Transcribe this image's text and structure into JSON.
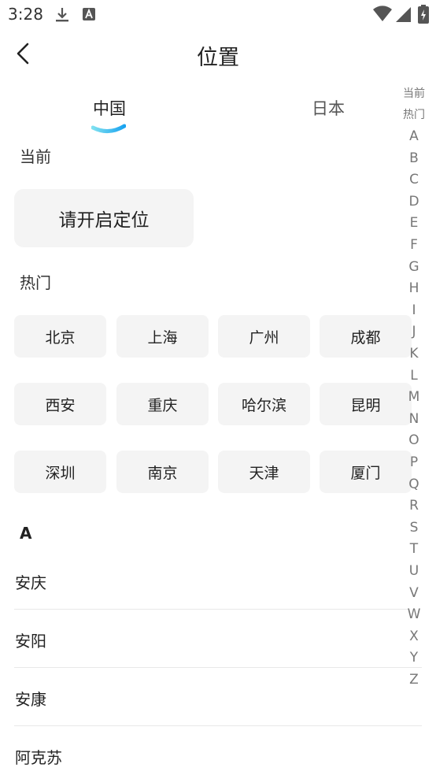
{
  "status_bar": {
    "time": "3:28"
  },
  "nav": {
    "title": "位置"
  },
  "tabs": [
    {
      "label": "中国",
      "active": true
    },
    {
      "label": "日本",
      "active": false
    }
  ],
  "current_section": {
    "label": "当前",
    "locate_button": "请开启定位"
  },
  "hot_section": {
    "label": "热门",
    "cities": [
      "北京",
      "上海",
      "广州",
      "成都",
      "西安",
      "重庆",
      "哈尔滨",
      "昆明",
      "深圳",
      "南京",
      "天津",
      "厦门"
    ]
  },
  "city_list": {
    "group_letter": "A",
    "items": [
      "安庆",
      "安阳",
      "安康",
      "阿克苏"
    ]
  },
  "index_bar": [
    "当前",
    "热门",
    "A",
    "B",
    "C",
    "D",
    "E",
    "F",
    "G",
    "H",
    "I",
    "J",
    "K",
    "L",
    "M",
    "N",
    "O",
    "P",
    "Q",
    "R",
    "S",
    "T",
    "U",
    "V",
    "W",
    "X",
    "Y",
    "Z"
  ],
  "colors": {
    "accent_start": "#7ee0f0",
    "accent_end": "#1aa3f0",
    "chip_bg": "#f4f4f4"
  }
}
